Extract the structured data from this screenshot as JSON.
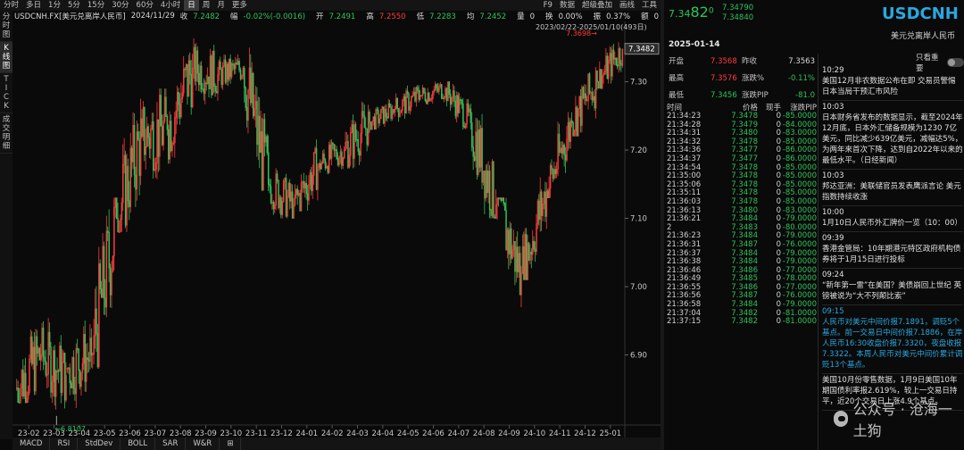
{
  "toolbar": {
    "items": [
      "分时",
      "多日",
      "1分",
      "5分",
      "15分",
      "30分",
      "60分",
      "4小时",
      "日",
      "周",
      "月",
      "更多"
    ],
    "active_index": 8,
    "right_items": [
      "F9",
      "数据",
      "超级叠加",
      "画线",
      "工具"
    ]
  },
  "side_tabs": [
    "分时图",
    "K线图",
    "TICK",
    "成交明细"
  ],
  "side_active": 1,
  "info": {
    "symbol": "USDCNH.FX[美元兑离岸人民币]",
    "date": "2024/11/29",
    "close_label": "收",
    "close": "7.2482",
    "chg_label": "幅",
    "chg": "-0.02%(-0.0016)",
    "open_label": "开",
    "open": "7.2491",
    "high_label": "高",
    "high": "7.2550",
    "low_label": "低",
    "low": "7.2283",
    "avg_label": "均",
    "avg": "7.2452",
    "vol_label": "量",
    "vol": "0",
    "turnover_label": "换",
    "turnover": "0.00%",
    "amp_label": "振",
    "amp": "0.37%",
    "amount_label": "额",
    "amount": "0"
  },
  "range_text": "2023/02/22-2025/01/10(493日)",
  "bottom_tabs": [
    "MACD",
    "RSI",
    "StdDev",
    "BOLL",
    "SAR",
    "W&R",
    "⊞"
  ],
  "chart_data": {
    "type": "candlestick",
    "x_ticks": [
      "23-02",
      "23-03",
      "23-04",
      "23-05",
      "23-06",
      "23-07",
      "23-08",
      "23-09",
      "23-10",
      "23-11",
      "23-12",
      "24-01",
      "24-02",
      "24-03",
      "24-04",
      "24-05",
      "24-06",
      "24-07",
      "24-08",
      "24-09",
      "24-10",
      "24-11",
      "24-12",
      "25-01"
    ],
    "y_ticks": [
      6.9,
      7.0,
      7.1,
      7.2,
      7.3
    ],
    "ylim": [
      6.8,
      7.37
    ],
    "last_price": "7.3482",
    "high_marker": "7.3698",
    "low_marker": "6.8107",
    "monthly": [
      [
        6.85,
        6.9,
        6.83,
        6.99,
        "u"
      ],
      [
        6.9,
        6.87,
        6.82,
        6.97,
        "d"
      ],
      [
        6.88,
        6.9,
        6.811,
        6.96,
        "u"
      ],
      [
        6.9,
        7.1,
        6.88,
        7.13,
        "u"
      ],
      [
        7.1,
        7.22,
        7.08,
        7.29,
        "u"
      ],
      [
        7.22,
        7.23,
        7.11,
        7.29,
        "u"
      ],
      [
        7.23,
        7.32,
        7.18,
        7.36,
        "u"
      ],
      [
        7.32,
        7.31,
        7.26,
        7.37,
        "d"
      ],
      [
        7.31,
        7.32,
        7.27,
        7.34,
        "u"
      ],
      [
        7.32,
        7.15,
        7.14,
        7.35,
        "d"
      ],
      [
        7.15,
        7.12,
        7.1,
        7.2,
        "d"
      ],
      [
        7.12,
        7.18,
        7.11,
        7.22,
        "u"
      ],
      [
        7.18,
        7.2,
        7.15,
        7.22,
        "u"
      ],
      [
        7.2,
        7.24,
        7.17,
        7.28,
        "u"
      ],
      [
        7.24,
        7.26,
        7.23,
        7.28,
        "u"
      ],
      [
        7.26,
        7.28,
        7.24,
        7.3,
        "u"
      ],
      [
        7.28,
        7.29,
        7.25,
        7.3,
        "u"
      ],
      [
        7.29,
        7.24,
        7.23,
        7.3,
        "d"
      ],
      [
        7.24,
        7.12,
        7.1,
        7.26,
        "d"
      ],
      [
        7.12,
        7.02,
        6.97,
        7.13,
        "d"
      ],
      [
        7.02,
        7.14,
        7.01,
        7.16,
        "u"
      ],
      [
        7.14,
        7.24,
        7.13,
        7.26,
        "u"
      ],
      [
        7.24,
        7.3,
        7.22,
        7.33,
        "u"
      ],
      [
        7.3,
        7.348,
        7.29,
        7.37,
        "u"
      ]
    ]
  },
  "quote": {
    "price_small": "7.34",
    "price_big": "82",
    "price_tail": "0",
    "bid": "7.34790",
    "ask": "7.34840",
    "symbol": "USDCNH",
    "name": "美元兑离岸人民币",
    "date": "2025-01-14"
  },
  "stats": [
    {
      "k": "开盘",
      "v": "7.3568",
      "vc": "r",
      "k2": "昨收",
      "v2": "7.3563",
      "v2c": "w"
    },
    {
      "k": "最高",
      "v": "7.3576",
      "vc": "r",
      "k2": "涨跌%",
      "v2": "-0.11%",
      "v2c": "g"
    },
    {
      "k": "最低",
      "v": "7.3456",
      "vc": "g",
      "k2": "涨跌PIP",
      "v2": "-81.0",
      "v2c": "g"
    }
  ],
  "ticks_header": [
    "时间",
    "价格",
    "现手",
    "涨跌PIP"
  ],
  "ticks": [
    [
      "21:34:23",
      "7.3478",
      "0",
      "-85.0000"
    ],
    [
      "21:34:28",
      "7.3479",
      "0",
      "-84.0000"
    ],
    [
      "21:34:31",
      "7.3480",
      "0",
      "-83.0000"
    ],
    [
      "21:34:32",
      "7.3478",
      "0",
      "-85.0000"
    ],
    [
      "21:34:36",
      "7.3477",
      "0",
      "-86.0000"
    ],
    [
      "21:34:37",
      "7.3477",
      "0",
      "-86.0000"
    ],
    [
      "21:34:54",
      "7.3478",
      "0",
      "-85.0000"
    ],
    [
      "21:35:00",
      "7.3478",
      "0",
      "-85.0000"
    ],
    [
      "21:35:06",
      "7.3478",
      "0",
      "-85.0000"
    ],
    [
      "21:35:11",
      "7.3478",
      "0",
      "-85.0000"
    ],
    [
      "21:36:03",
      "7.3478",
      "0",
      "-85.0000"
    ],
    [
      "21:36:13",
      "7.3480",
      "0",
      "-83.0000"
    ],
    [
      "21:36:21",
      "7.3484",
      "0",
      "-79.0000"
    ],
    [
      "2",
      "7.3483",
      "0",
      "-80.0000"
    ],
    [
      "21:36:23",
      "7.3484",
      "0",
      "-79.0000"
    ],
    [
      "21:36:31",
      "7.3487",
      "0",
      "-76.0000"
    ],
    [
      "21:36:37",
      "7.3484",
      "0",
      "-79.0000"
    ],
    [
      "21:36:38",
      "7.3484",
      "0",
      "-79.0000"
    ],
    [
      "21:36:46",
      "7.3486",
      "0",
      "-77.0000"
    ],
    [
      "21:36:49",
      "7.3485",
      "0",
      "-78.0000"
    ],
    [
      "21:36:55",
      "7.3486",
      "0",
      "-77.0000"
    ],
    [
      "21:36:56",
      "7.3487",
      "0",
      "-76.0000"
    ],
    [
      "21:36:58",
      "7.3484",
      "0",
      "-79.0000"
    ],
    [
      "21:37:04",
      "7.3482",
      "0",
      "-81.0000"
    ],
    [
      "21:37:15",
      "7.3482",
      "0",
      "-81.0000"
    ]
  ],
  "news_filter": "只看重要",
  "news": [
    {
      "time": "10:29",
      "text": "美国12月非农数据公布在即 交易员警惕日本当局干预汇市风险",
      "hl": false
    },
    {
      "time": "10:03",
      "text": "日本财务省发布的数据显示，截至2024年12月底，日本外汇储备规模为1230 7亿美元，同比减少639亿美元，减幅达5%，为两年来首次下降，达到自2022年以来的最低水平。（日经新闻）",
      "hl": false
    },
    {
      "time": "10:03",
      "text": "邦达亚洲：美联储官员发表鹰派言论 美元指数持续收涨",
      "hl": false
    },
    {
      "time": "10:00",
      "text": "1月10日人民币外汇牌价一览（10：00）",
      "hl": false
    },
    {
      "time": "09:39",
      "text": "香港金管局：10年期港元特区政府机构债券将于1月15日进行投标",
      "hl": false
    },
    {
      "time": "09:24",
      "text": "“新年第一雷”在美国？美债崩回上世纪 英镑被说为“大不列颠比索”",
      "hl": false
    },
    {
      "time": "09:15",
      "text": "人民币对美元中间价报7.1891，调贬5个基点。前一交易日中间价报7.1886，在岸人民币16:30收盘价报7.3320，夜盘收报7.3322。本周人民币对美元中间价累计调贬13个基点。",
      "hl": true
    },
    {
      "time": "",
      "text": "美国10月份零售数据，1月9日美国10年期国债利率报2.619%，较上一交易日持平，近20个交易日上涨4.9个基点。",
      "hl": false
    }
  ],
  "watermark": "公众号 · 沧海一土狗"
}
